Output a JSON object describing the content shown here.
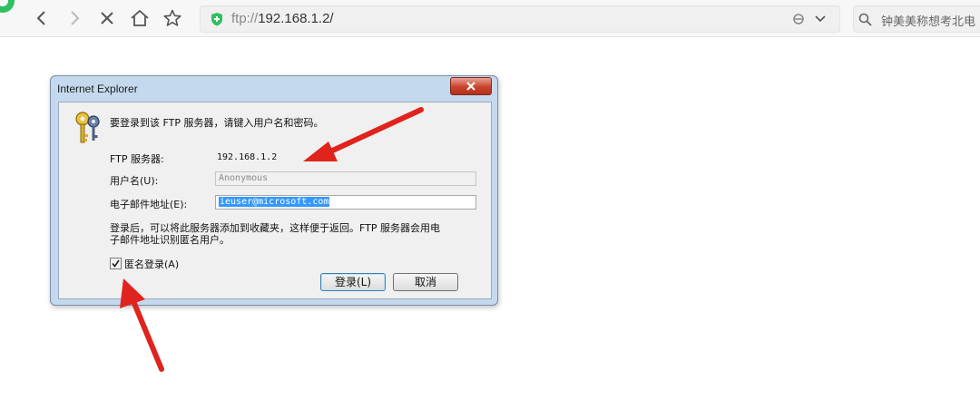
{
  "browser": {
    "url_scheme": "ftp://",
    "url_host": "192.168.1.2/",
    "search_text": "钟美美称想考北电"
  },
  "dialog": {
    "title": "Internet Explorer",
    "prompt": "要登录到该 FTP 服务器，请键入用户名和密码。",
    "server_label": "FTP 服务器:",
    "server_value": "192.168.1.2",
    "username_label": "用户名(U):",
    "username_value": "Anonymous",
    "email_label": "电子邮件地址(E):",
    "email_value": "ieuser@microsoft.com",
    "note_line1": "登录后，可以将此服务器添加到收藏夹，这样便于返回。FTP 服务器会用电",
    "note_line2": "子邮件地址识别匿名用户。",
    "anonymous_label": "匿名登录(A)",
    "anonymous_checked": true,
    "login_button": "登录(L)",
    "cancel_button": "取消"
  },
  "colors": {
    "annotation_arrow": "#e0231c",
    "secure_icon": "#2fbf5f"
  }
}
